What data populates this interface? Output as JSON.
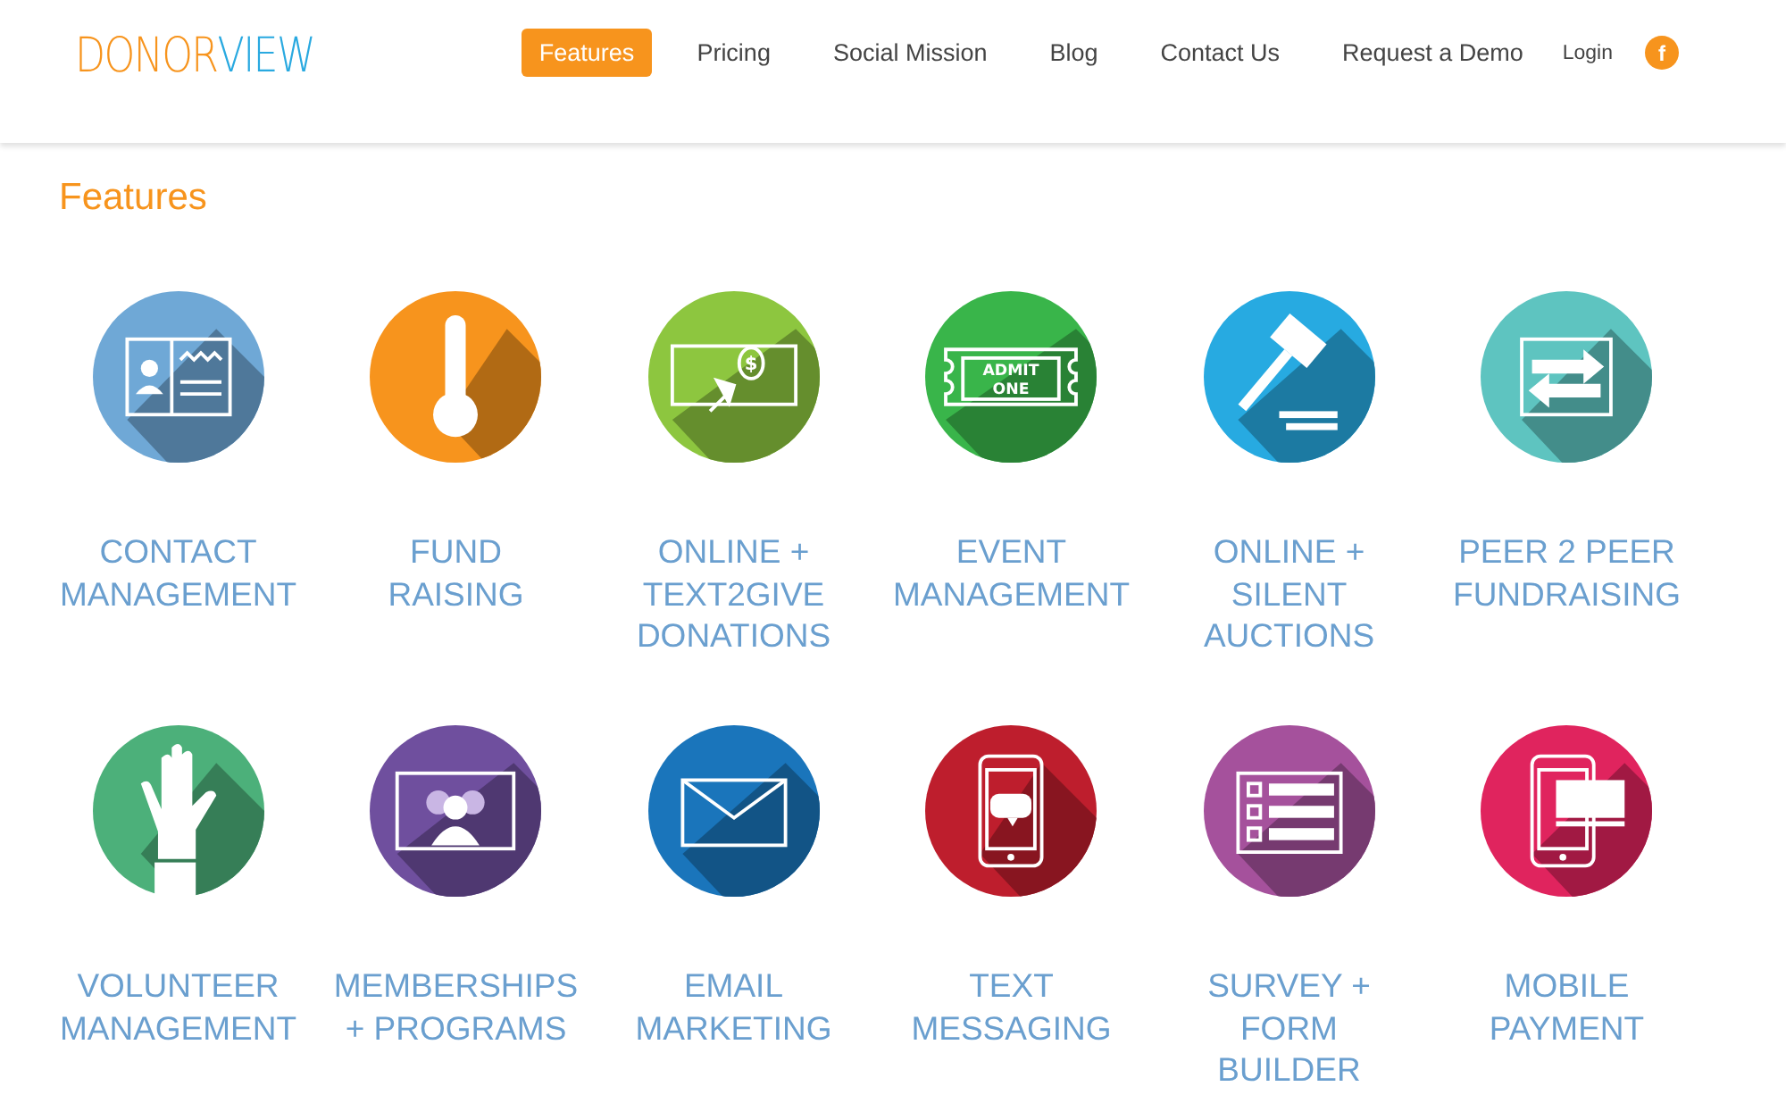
{
  "header": {
    "logo": [
      {
        "text": "DONOR",
        "color": "#f7941d"
      },
      {
        "text": "VIEW",
        "color": "#29a9e0"
      }
    ],
    "nav": [
      {
        "label": "Features",
        "selected": true
      },
      {
        "label": "Pricing",
        "selected": false
      },
      {
        "label": "Social Mission",
        "selected": false
      },
      {
        "label": "Blog",
        "selected": false
      },
      {
        "label": "Contact Us",
        "selected": false
      },
      {
        "label": "Request a Demo",
        "selected": false
      }
    ],
    "login": "Login",
    "social": "f"
  },
  "heading": "Features",
  "features": [
    {
      "lines": [
        "CONTACT",
        "MANAGEMENT"
      ],
      "color": "#6fa8d6"
    },
    {
      "lines": [
        "FUND",
        "RAISING"
      ],
      "color": "#f7941d"
    },
    {
      "lines": [
        "ONLINE +",
        "TEXT2GIVE",
        "DONATIONS"
      ],
      "color": "#8dc63f",
      "icon_text": [
        "$"
      ]
    },
    {
      "lines": [
        "EVENT",
        "MANAGEMENT"
      ],
      "color": "#39b54a",
      "icon_text": [
        "ADMIT",
        "ONE"
      ]
    },
    {
      "lines": [
        "ONLINE +",
        "SILENT",
        "AUCTIONS"
      ],
      "color": "#27aae1"
    },
    {
      "lines": [
        "PEER 2 PEER",
        "FUNDRAISING"
      ],
      "color": "#5ec4c0"
    },
    {
      "lines": [
        "VOLUNTEER",
        "MANAGEMENT"
      ],
      "color": "#4cb07a"
    },
    {
      "lines": [
        "MEMBERSHIPS",
        "+ PROGRAMS"
      ],
      "color": "#6f4f9e"
    },
    {
      "lines": [
        "EMAIL",
        "MARKETING"
      ],
      "color": "#1a75bb"
    },
    {
      "lines": [
        "TEXT",
        "MESSAGING"
      ],
      "color": "#be1e2d"
    },
    {
      "lines": [
        "SURVEY +",
        "FORM",
        "BUILDER"
      ],
      "color": "#a5519c"
    },
    {
      "lines": [
        "MOBILE",
        "PAYMENT"
      ],
      "color": "#e0245e"
    }
  ]
}
